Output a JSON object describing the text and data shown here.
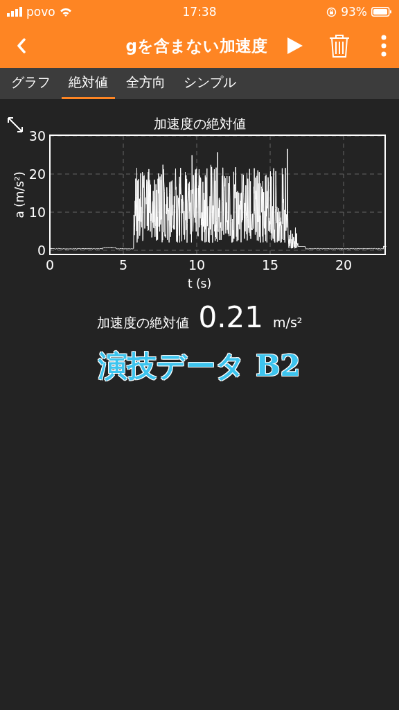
{
  "status_bar": {
    "carrier": "povo",
    "time": "17:38",
    "battery": "93%"
  },
  "toolbar": {
    "title": "gを含まない加速度"
  },
  "tabs": [
    {
      "label": "グラフ",
      "selected": false
    },
    {
      "label": "絶対値",
      "selected": true
    },
    {
      "label": "全方向",
      "selected": false
    },
    {
      "label": "シンプル",
      "selected": false
    }
  ],
  "graph": {
    "title": "加速度の絶対値",
    "ylabel": "a (m/s²)",
    "xlabel": "t (s)",
    "xticks": [
      "0",
      "5",
      "10",
      "15",
      "20"
    ],
    "yticks": [
      "30",
      "20",
      "10",
      "0"
    ]
  },
  "readout": {
    "label": "加速度の絶対値",
    "value": "0.21",
    "unit": "m/s²"
  },
  "caption": "演技データ B2"
}
